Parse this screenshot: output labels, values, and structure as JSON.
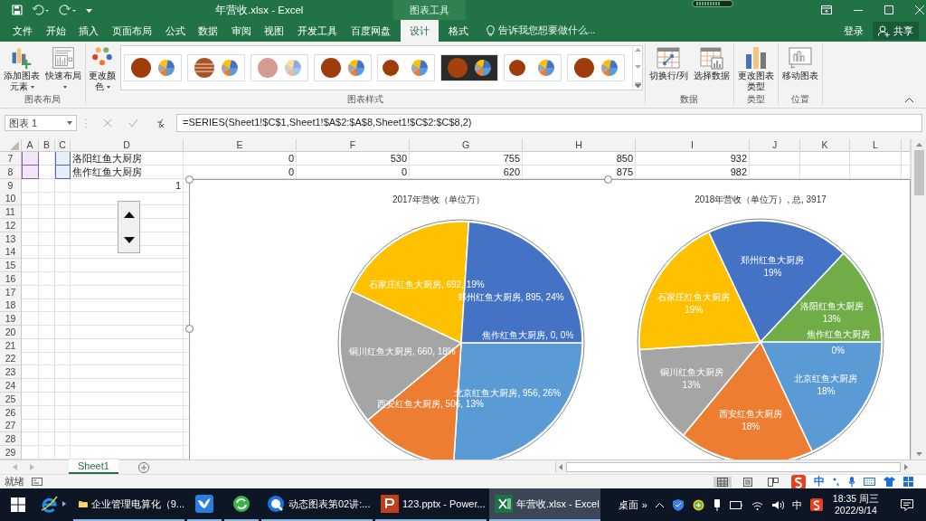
{
  "window": {
    "title": "年营收.xlsx - Excel",
    "contextual_tab_group": "图表工具"
  },
  "ribbon_tabs": [
    {
      "label": "文件",
      "selected": false
    },
    {
      "label": "开始",
      "selected": false
    },
    {
      "label": "插入",
      "selected": false
    },
    {
      "label": "页面布局",
      "selected": false
    },
    {
      "label": "公式",
      "selected": false
    },
    {
      "label": "数据",
      "selected": false
    },
    {
      "label": "审阅",
      "selected": false
    },
    {
      "label": "视图",
      "selected": false
    },
    {
      "label": "开发工具",
      "selected": false
    },
    {
      "label": "百度网盘",
      "selected": false
    },
    {
      "label": "设计",
      "selected": true
    },
    {
      "label": "格式",
      "selected": false
    }
  ],
  "tell_me": {
    "placeholder": "告诉我您想要做什么..."
  },
  "account": {
    "sign_in": "登录",
    "share": "共享"
  },
  "ribbon": {
    "layout_group": {
      "label": "图表布局",
      "buttons": [
        {
          "label": "添加图表元素",
          "dropdown": true,
          "kind": "add-element"
        },
        {
          "label": "快速布局",
          "dropdown": true,
          "kind": "layout"
        }
      ]
    },
    "style_group": {
      "label": "图表样式",
      "colors_button": {
        "label": "更改颜色",
        "dropdown": true
      },
      "styles": [
        {
          "kind": "solid"
        },
        {
          "kind": "banded"
        },
        {
          "kind": "pale"
        },
        {
          "kind": "solid"
        },
        {
          "kind": "small"
        },
        {
          "kind": "dark"
        },
        {
          "kind": "small"
        },
        {
          "kind": "solid"
        }
      ]
    },
    "data_group": {
      "label": "数据",
      "buttons": [
        {
          "label": "切换行/列",
          "kind": "switch"
        },
        {
          "label": "选择数据",
          "kind": "select"
        }
      ]
    },
    "type_group": {
      "label": "类型",
      "buttons": [
        {
          "label": "更改图表类型",
          "kind": "type"
        }
      ]
    },
    "location_group": {
      "label": "位置",
      "buttons": [
        {
          "label": "移动图表",
          "kind": "move"
        }
      ]
    }
  },
  "formula_bar": {
    "name_box": "图表 1",
    "formula": "=SERIES(Sheet1!$C$1,Sheet1!$A$2:$A$8,Sheet1!$C$2:$C$8,2)"
  },
  "sheet": {
    "columns": [
      "A",
      "B",
      "C",
      "D",
      "E",
      "F",
      "G",
      "H",
      "I",
      "J",
      "K",
      "L"
    ],
    "rows": [
      {
        "number": "7",
        "referenced": true,
        "cells": [
          {
            "value": "洛阳红鱼大厨房",
            "kind": "text"
          },
          {
            "value": "0",
            "kind": "number"
          },
          {
            "value": "530",
            "kind": "number"
          },
          {
            "value": "755",
            "kind": "number"
          },
          {
            "value": "850",
            "kind": "number"
          },
          {
            "value": "932",
            "kind": "number"
          }
        ]
      },
      {
        "number": "8",
        "referenced": true,
        "cells": [
          {
            "value": "焦作红鱼大厨房",
            "kind": "text"
          },
          {
            "value": "0",
            "kind": "number"
          },
          {
            "value": "0",
            "kind": "number"
          },
          {
            "value": "620",
            "kind": "number"
          },
          {
            "value": "875",
            "kind": "number"
          },
          {
            "value": "982",
            "kind": "number"
          }
        ]
      },
      {
        "number": "9",
        "referenced": false,
        "cells": [
          {
            "value": "1",
            "kind": "number"
          }
        ]
      },
      {
        "number": "10",
        "referenced": false
      },
      {
        "number": "11",
        "referenced": false
      },
      {
        "number": "12",
        "referenced": false
      },
      {
        "number": "13",
        "referenced": false
      },
      {
        "number": "14",
        "referenced": false
      },
      {
        "number": "15",
        "referenced": false
      },
      {
        "number": "16",
        "referenced": false
      },
      {
        "number": "17",
        "referenced": false
      },
      {
        "number": "18",
        "referenced": false
      },
      {
        "number": "19",
        "referenced": false
      },
      {
        "number": "20",
        "referenced": false
      },
      {
        "number": "21",
        "referenced": false
      },
      {
        "number": "22",
        "referenced": false
      },
      {
        "number": "23",
        "referenced": false
      },
      {
        "number": "24",
        "referenced": false
      },
      {
        "number": "25",
        "referenced": false
      },
      {
        "number": "26",
        "referenced": false
      },
      {
        "number": "27",
        "referenced": false
      },
      {
        "number": "28",
        "referenced": false
      },
      {
        "number": "29",
        "referenced": false
      }
    ]
  },
  "charts": [
    {
      "kind": "inline",
      "chart_data": {
        "type": "pie",
        "title": "2017年营收（单位万）",
        "categories": [
          "北京红鱼大厨房",
          "西安红鱼大厨房",
          "铜川红鱼大厨房",
          "石家庄红鱼大厨房",
          "郑州红鱼大厨房",
          "焦作红鱼大厨房"
        ],
        "values": [
          26,
          13,
          18,
          19,
          24,
          0
        ],
        "colors": [
          "#5b9bd5",
          "#ed7d31",
          "#a5a5a5",
          "#ffc000",
          "#4472c4",
          "#70ad47"
        ]
      },
      "labels": [
        {
          "value_text": ", 956, 26%"
        },
        {
          "value_text": ", 506, 13%"
        },
        {
          "value_text": ", 660, 18%"
        },
        {
          "value_text": ", 692, 19%"
        },
        {
          "value_text": ", 895, 24%"
        },
        {
          "value_text": ", 0, 0%"
        }
      ]
    },
    {
      "kind": "stacked",
      "chart_data": {
        "type": "pie",
        "title": "2018年营收（单位万）, 总, 3917",
        "categories": [
          "北京红鱼大厨房",
          "西安红鱼大厨房",
          "铜川红鱼大厨房",
          "石家庄红鱼大厨房",
          "郑州红鱼大厨房",
          "洛阳红鱼大厨房",
          "焦作红鱼大厨房"
        ],
        "values": [
          18,
          18,
          13,
          19,
          19,
          13,
          0
        ],
        "colors": [
          "#5b9bd5",
          "#ed7d31",
          "#a5a5a5",
          "#ffc000",
          "#4472c4",
          "#70ad47",
          "#264478"
        ]
      },
      "labels": [
        {
          "value_text": "18%"
        },
        {
          "value_text": "18%"
        },
        {
          "value_text": "13%"
        },
        {
          "value_text": "19%"
        },
        {
          "value_text": "19%"
        },
        {
          "value_text": "13%"
        },
        {
          "value_text": "0%"
        }
      ]
    }
  ],
  "sheet_tabs": [
    {
      "label": "Sheet1",
      "selected": true
    }
  ],
  "status_bar": {
    "status": "就绪",
    "ime_mode": "中"
  },
  "taskbar": {
    "items": [
      {
        "kind": "browser",
        "selected": false
      },
      {
        "kind": "folder",
        "label": "企业管理电算化（9...",
        "selected": false
      },
      {
        "kind": "bird",
        "selected": false
      },
      {
        "kind": "sync",
        "selected": false
      },
      {
        "kind": "player",
        "label": "动态图表第02讲:...",
        "selected": false
      },
      {
        "kind": "powerpoint",
        "label": "123.pptx - Power...",
        "selected": false
      },
      {
        "kind": "excel",
        "label": "年营收.xlsx - Excel",
        "selected": true
      }
    ],
    "desktop": "桌面",
    "more": "»",
    "ime": "中",
    "time": "18:35 周三",
    "date": "2022/9/14"
  }
}
